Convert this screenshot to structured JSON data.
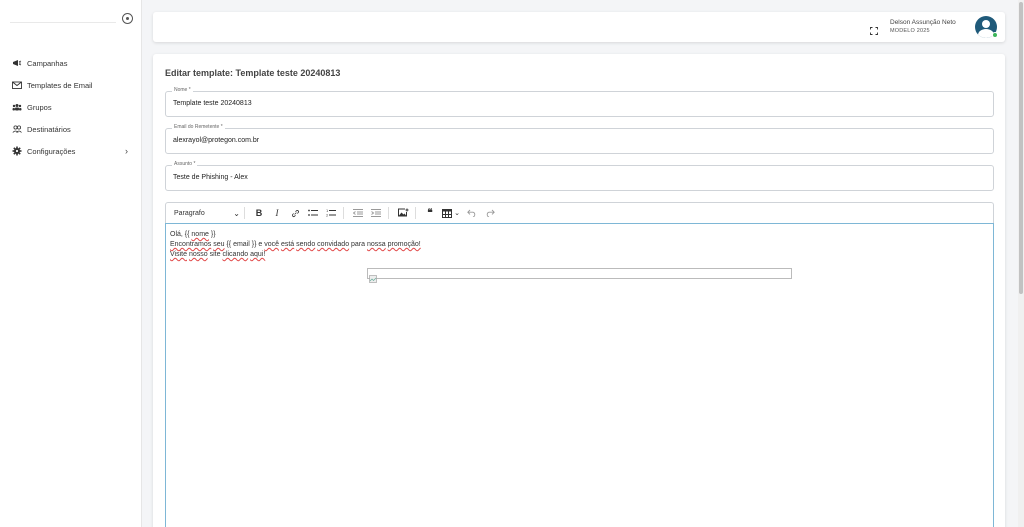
{
  "sidebar": {
    "items": [
      {
        "label": "Campanhas",
        "icon": "megaphone-icon"
      },
      {
        "label": "Templates de Email",
        "icon": "envelope-icon"
      },
      {
        "label": "Grupos",
        "icon": "users-icon"
      },
      {
        "label": "Destinatários",
        "icon": "user-group-icon"
      },
      {
        "label": "Configurações",
        "icon": "gear-icon",
        "has_submenu": true
      }
    ]
  },
  "header": {
    "user_name": "Delson Assunção Neto",
    "user_subtitle": "MODELO 2025",
    "status_color": "#3cb55a"
  },
  "main": {
    "title": "Editar template: Template teste 20240813",
    "fields": {
      "nome": {
        "label": "Nome *",
        "value": "Template teste 20240813"
      },
      "email": {
        "label": "Email do Remetente *",
        "value": "alexrayol@protegon.com.br"
      },
      "assunto": {
        "label": "Assunto *",
        "value": "Teste de Phishing - Alex"
      }
    },
    "editor": {
      "toolbar": {
        "paragraph_select": "Paragrafo"
      },
      "content": {
        "line1_a": "Olá, {{ ",
        "line1_b": "nome",
        "line1_c": " }}",
        "line2_a": "Encontramos",
        "line2_b": " ",
        "line2_c": "seu",
        "line2_d": " {{ email }} e ",
        "line2_e": "você",
        "line2_f": " ",
        "line2_g": "está",
        "line2_h": " ",
        "line2_i": "sendo",
        "line2_j": " ",
        "line2_k": "convidado",
        "line2_l": " para ",
        "line2_m": "nossa",
        "line2_n": " ",
        "line2_o": "promoção!",
        "line3_a": "Visite",
        "line3_b": " ",
        "line3_c": "nosso",
        "line3_d": " site ",
        "line3_e": "clicando",
        "line3_f": " ",
        "line3_g": "aqui!"
      }
    }
  }
}
